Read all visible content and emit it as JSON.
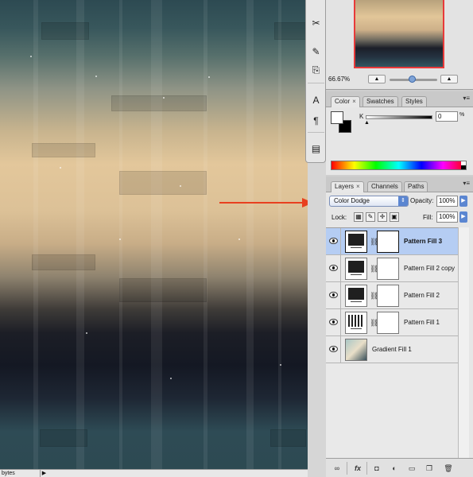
{
  "navigator": {
    "zoom": "66.67%",
    "zoom_out_icon": "small-mountain-icon",
    "zoom_in_icon": "large-mountain-icon",
    "zoom_slider_level": 0.42
  },
  "color_panel": {
    "tabs": [
      {
        "label": "Color",
        "close": "×"
      },
      {
        "label": "Swatches"
      },
      {
        "label": "Styles"
      }
    ],
    "channel_label": "K",
    "channel_value": "0",
    "channel_unit": "%"
  },
  "layers_panel": {
    "tabs": [
      {
        "label": "Layers",
        "close": "×"
      },
      {
        "label": "Channels"
      },
      {
        "label": "Paths"
      }
    ],
    "blend_mode": "Color Dodge",
    "opacity_label": "Opacity:",
    "opacity_value": "100%",
    "lock_label": "Lock:",
    "fill_label": "Fill:",
    "fill_value": "100%",
    "layers": [
      {
        "name": "Pattern Fill 3",
        "selected": true,
        "visible": true,
        "thumb": "solid"
      },
      {
        "name": "Pattern Fill 2 copy",
        "selected": false,
        "visible": true,
        "thumb": "solid"
      },
      {
        "name": "Pattern Fill 2",
        "selected": false,
        "visible": true,
        "thumb": "solid"
      },
      {
        "name": "Pattern Fill 1",
        "selected": false,
        "visible": true,
        "thumb": "pattern"
      },
      {
        "name": "Gradient Fill 1",
        "selected": false,
        "visible": true,
        "thumb": "gradient"
      }
    ],
    "footer_buttons": [
      "link-layers-icon",
      "fx-icon",
      "add-mask-icon",
      "adjustment-layer-icon",
      "new-group-icon",
      "new-layer-icon",
      "trash-icon"
    ]
  },
  "statusbar": {
    "text": "bytes",
    "arrow": "▶"
  },
  "colors": {
    "annotation_arrow": "#e8401f",
    "selected_layer": "#b5cdf3",
    "nav_frame": "#e83a3a"
  }
}
